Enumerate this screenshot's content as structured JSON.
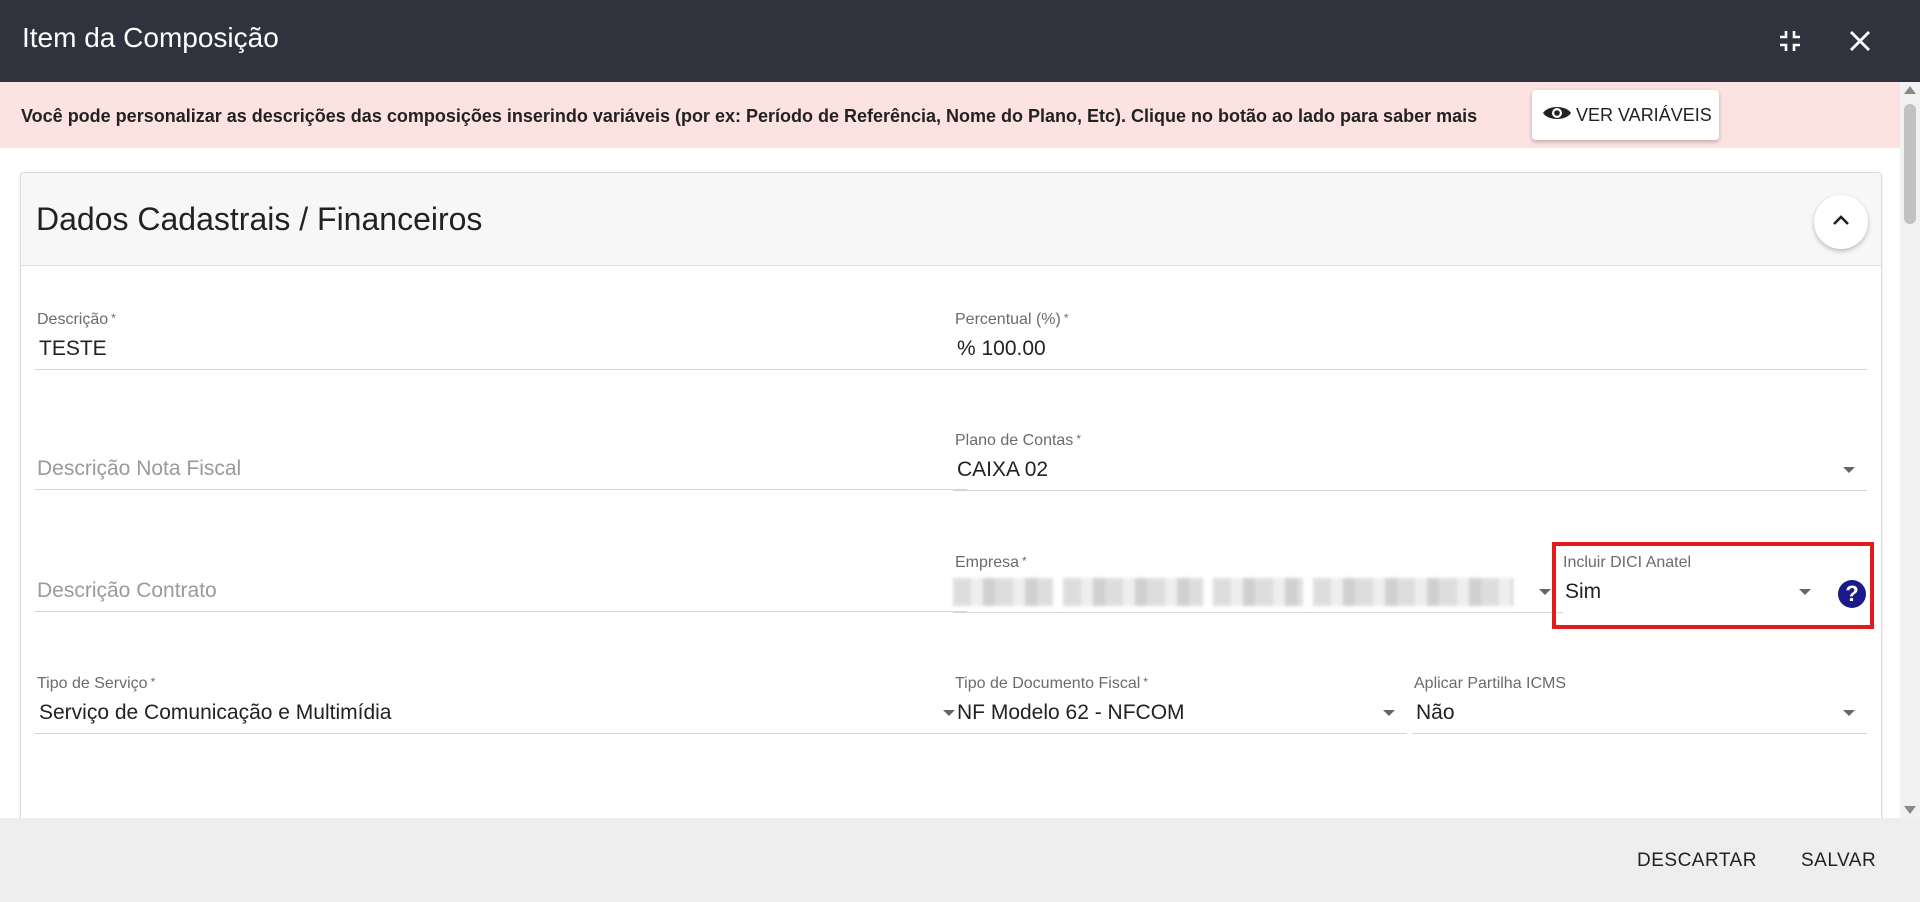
{
  "window": {
    "title": "Item da Composição",
    "icons": {
      "minimize": "compress-icon",
      "close": "close-icon"
    }
  },
  "banner": {
    "message": "Você pode personalizar as descrições das composições inserindo variáveis (por ex: Período de Referência, Nome do Plano, Etc). Clique no botão ao lado para saber mais",
    "button_label": "VER VARIÁVEIS",
    "button_icon": "eye-icon",
    "background": "#fde2e2"
  },
  "section": {
    "title": "Dados Cadastrais / Financeiros",
    "collapse_icon": "chevron-up-icon"
  },
  "fields": {
    "descricao": {
      "label": "Descrição",
      "required": "*",
      "value": "TESTE"
    },
    "percentual": {
      "label": "Percentual (%)",
      "required": "*",
      "value": "% 100.00"
    },
    "descricao_nf": {
      "placeholder": "Descrição Nota Fiscal"
    },
    "plano_contas": {
      "label": "Plano de Contas",
      "required": "*",
      "value": "CAIXA 02"
    },
    "descricao_contrato": {
      "placeholder": "Descrição Contrato"
    },
    "empresa": {
      "label": "Empresa",
      "required": "*"
    },
    "incluir_dici": {
      "label": "Incluir DICI Anatel",
      "value": "Sim",
      "help": "?"
    },
    "tipo_servico": {
      "label": "Tipo de Serviço",
      "required": "*",
      "value": "Serviço de Comunicação e Multimídia"
    },
    "tipo_documento": {
      "label": "Tipo de Documento Fiscal",
      "required": "*",
      "value": "NF Modelo 62 - NFCOM"
    },
    "partilha_icms": {
      "label": "Aplicar Partilha ICMS",
      "value": "Não"
    }
  },
  "footer": {
    "discard_label": "DESCARTAR",
    "save_label": "SALVAR"
  },
  "colors": {
    "titlebar": "#30333e",
    "highlight": "#e31b1b",
    "help_icon": "#1a1a8a"
  }
}
